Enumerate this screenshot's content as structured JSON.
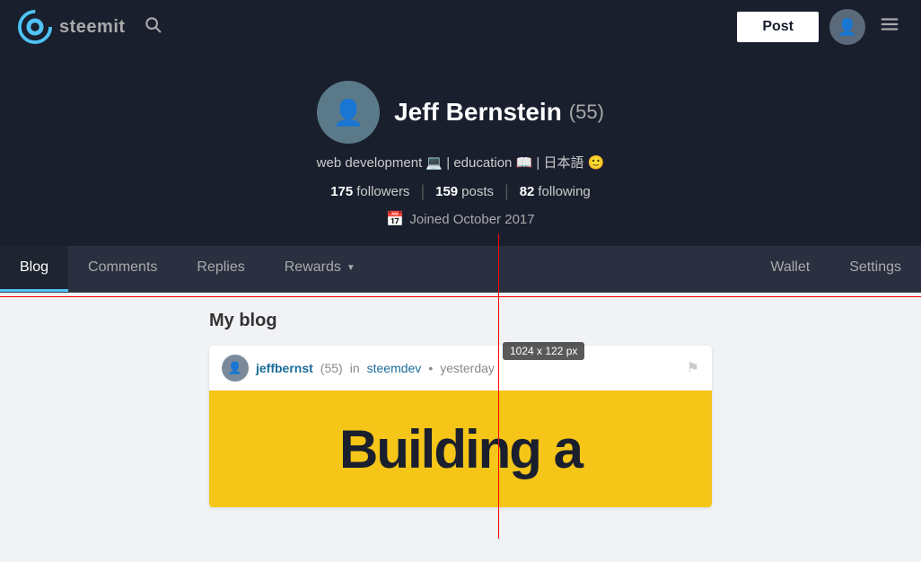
{
  "nav": {
    "logo_text": "steemit",
    "post_button": "Post",
    "search_placeholder": "Search"
  },
  "profile": {
    "name": "Jeff Bernstein",
    "reputation": "(55)",
    "bio": "web development 💻 | education 📖 | 日本語 🙂",
    "followers_count": "175",
    "followers_label": "followers",
    "posts_count": "159",
    "posts_label": "posts",
    "following_count": "82",
    "following_label": "following",
    "joined_label": "Joined October 2017"
  },
  "tabs": {
    "blog": "Blog",
    "comments": "Comments",
    "replies": "Replies",
    "rewards": "Rewards",
    "wallet": "Wallet",
    "settings": "Settings"
  },
  "main": {
    "blog_section_title": "My blog",
    "size_indicator": "1024 x 122 px"
  },
  "blog_post": {
    "author": "jeffbernst",
    "author_rep": "(55)",
    "community": "steemdev",
    "time": "yesterday",
    "image_text": "Building a"
  }
}
